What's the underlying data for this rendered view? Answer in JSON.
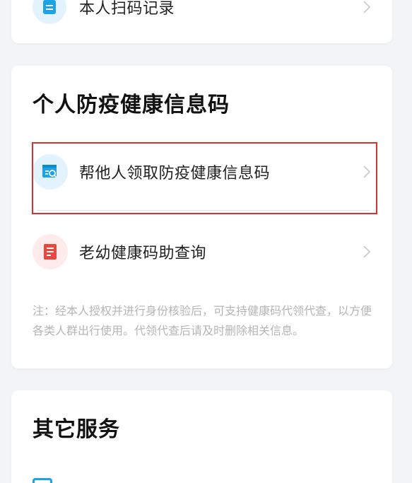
{
  "top_card": {
    "item_label": "本人扫码记录"
  },
  "health_section": {
    "title": "个人防疫健康信息码",
    "items": [
      {
        "label": "帮他人领取防疫健康信息码",
        "icon": "qr-search-icon"
      },
      {
        "label": "老幼健康码助查询",
        "icon": "elder-child-doc-icon"
      }
    ],
    "note": "注：经本人授权并进行身份核验后，可支持健康码代领代查，以方便各类人群出行使用。代领代查后请及时删除相关信息。"
  },
  "other_section": {
    "title": "其它服务"
  },
  "colors": {
    "icon_blue": "#1aa3e8",
    "icon_red": "#e8483f",
    "highlight": "#d9312b"
  }
}
